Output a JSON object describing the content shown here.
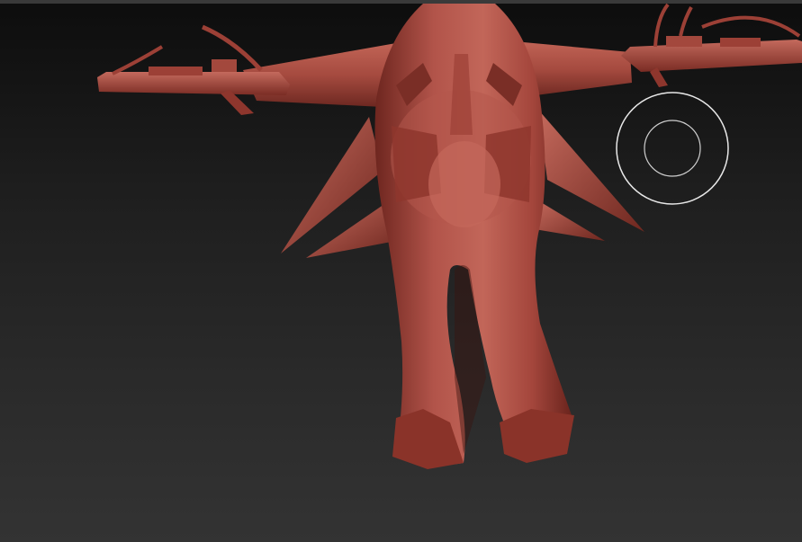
{
  "viewport": {
    "name": "sculpt-viewport",
    "model": "red-wax-sculpt-model"
  },
  "colors": {
    "background_top": "#0d0d0d",
    "background_bottom": "#333333",
    "material_base": "#a8463c",
    "material_highlight": "#c86a5e",
    "material_shadow": "#5e1f19",
    "brush_ring": "#e8e8e8"
  },
  "cursor": {
    "type": "brush-cursor-icon"
  }
}
